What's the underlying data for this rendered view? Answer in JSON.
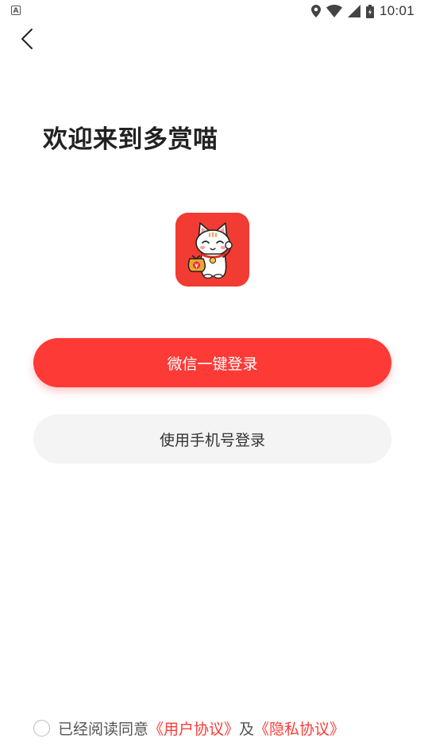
{
  "status_bar": {
    "time": "10:01",
    "left_badge": "A",
    "icons": [
      "location-icon",
      "wifi-icon",
      "cellular-signal-icon",
      "battery-icon"
    ]
  },
  "nav": {
    "back_icon": "chevron-left-icon"
  },
  "welcome": {
    "title": "欢迎来到多赏喵"
  },
  "logo": {
    "icon": "lucky-cat-logo",
    "background": "#f23b32"
  },
  "buttons": {
    "wechat_login": "微信一键登录",
    "phone_login": "使用手机号登录"
  },
  "agreement": {
    "prefix": "已经阅读同意",
    "user_agreement": "《用户协议》",
    "conjunction": "及",
    "privacy_agreement": "《隐私协议》"
  },
  "colors": {
    "accent": "#fe3a36",
    "secondary_button_bg": "#f4f4f4",
    "title_text": "#222222"
  }
}
